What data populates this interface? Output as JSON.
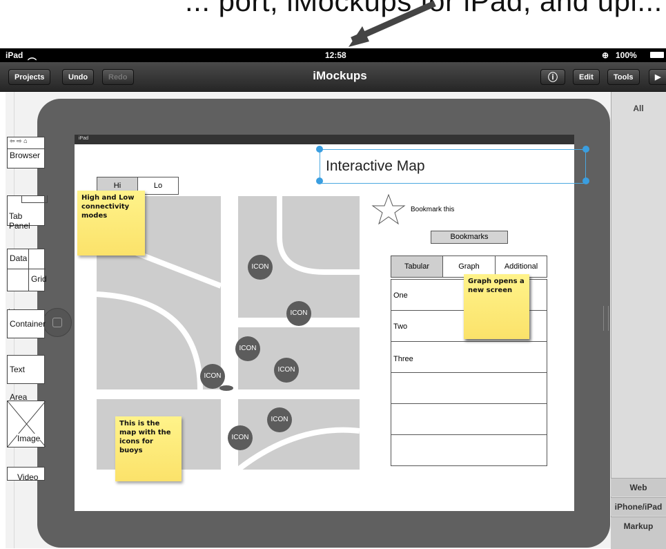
{
  "caption": {
    "text": "... port, iMockups for iPad, and upl..."
  },
  "status_bar": {
    "device": "iPad",
    "time": "12:58",
    "battery": "100%"
  },
  "toolbar": {
    "projects": "Projects",
    "undo": "Undo",
    "redo": "Redo",
    "title": "iMockups",
    "info": "ⓘ",
    "edit": "Edit",
    "tools": "Tools",
    "play": "▶"
  },
  "mockup": {
    "mini_status": "iPad",
    "segment": {
      "hi": "Hi",
      "lo": "Lo"
    },
    "title": "Interactive Map",
    "bookmark_label": "Bookmark this",
    "bookmarks_button": "Bookmarks",
    "map_icons": [
      "ICON",
      "ICON",
      "ICON",
      "ICON",
      "ICON",
      "ICON",
      "ICON"
    ],
    "tabs": [
      "Tabular",
      "Graph",
      "Additional"
    ],
    "rows": [
      "One",
      "Two",
      "Three",
      "",
      "",
      ""
    ],
    "notes": {
      "modes": "High and Low connectivity modes",
      "graph": "Graph opens a new screen",
      "map": "This is the map with the icons for buoys"
    }
  },
  "palette": {
    "all": "All",
    "browser": "Browser",
    "tab_panel": "Tab Panel",
    "data": "Data",
    "grid": "Grid",
    "container": "Container",
    "text_area": "Text Area",
    "image": "Image",
    "video": "Video",
    "sections": [
      "Web",
      "iPhone/iPad",
      "Markup"
    ]
  },
  "colors": {
    "selection": "#3a9ee0",
    "sticky": "#fbe26a",
    "toolbar": "#2f2f2f"
  }
}
